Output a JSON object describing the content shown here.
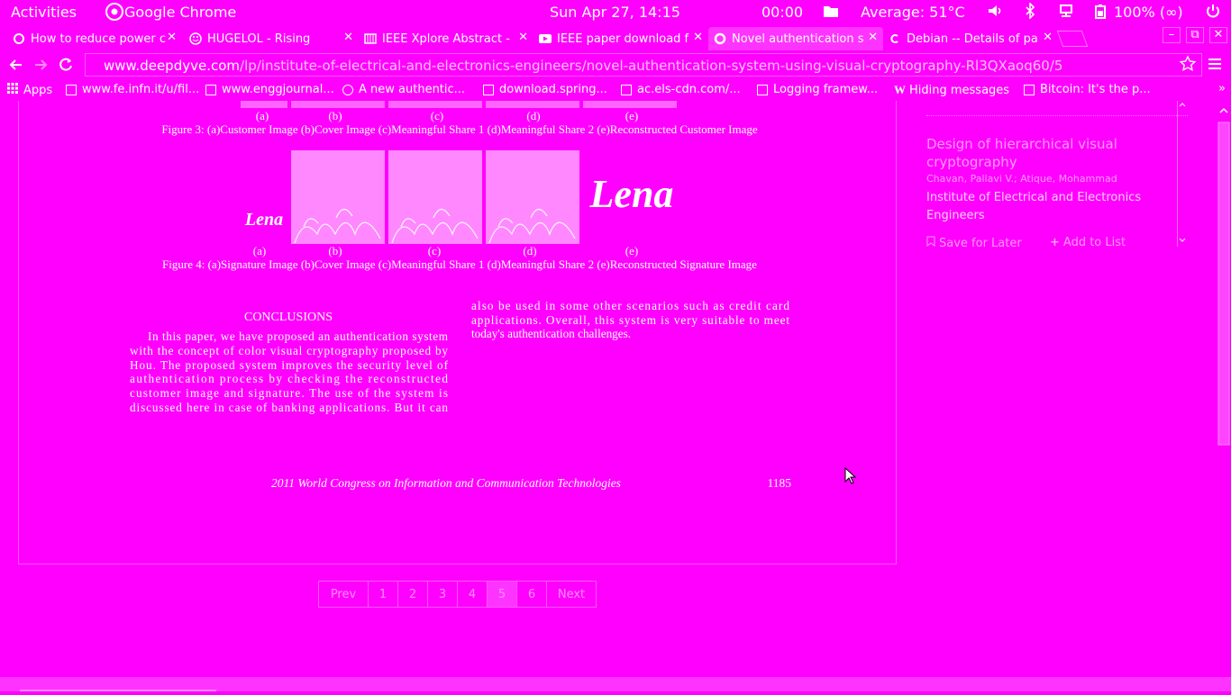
{
  "topbar": {
    "activities": "Activities",
    "app_name": "Google Chrome",
    "datetime": "Sun Apr 27, 14:15",
    "timer": "00:00",
    "temperature": "Average: 51°C",
    "battery": "100% (∞)"
  },
  "tabs": [
    {
      "title": "How to reduce power c"
    },
    {
      "title": "HUGELOL - Rising"
    },
    {
      "title": "IEEE Xplore Abstract -"
    },
    {
      "title": "IEEE paper download f"
    },
    {
      "title": "Novel authentication s"
    },
    {
      "title": "Debian -- Details of pa"
    }
  ],
  "omnibox": {
    "host": "www.deepdyve.com",
    "path": "/lp/institute-of-electrical-and-electronics-engineers/novel-authentication-system-using-visual-cryptography-Rl3QXaoq60/5"
  },
  "bookmarks": [
    {
      "label": "Apps"
    },
    {
      "label": "www.fe.infn.it/u/fil..."
    },
    {
      "label": "www.enggjournal..."
    },
    {
      "label": "A new authentic..."
    },
    {
      "label": "download.spring..."
    },
    {
      "label": "ac.els-cdn.com/..."
    },
    {
      "label": "Logging framew..."
    },
    {
      "label": "Hiding messages"
    },
    {
      "label": "Bitcoin: It's the p..."
    }
  ],
  "document": {
    "fig3_labels": [
      "(a)",
      "(b)",
      "(c)",
      "(d)",
      "(e)"
    ],
    "fig3_caption": "Figure 3: (a)Customer Image (b)Cover Image (c)Meaningful Share 1 (d)Meaningful Share 2 (e)Reconstructed Customer Image",
    "fig4_signature_small": "Lena",
    "fig4_signature_large": "Lena",
    "fig4_labels": [
      "(a)",
      "(b)",
      "(c)",
      "(d)",
      "(e)"
    ],
    "fig4_caption": "Figure 4: (a)Signature Image (b)Cover Image (c)Meaningful Share 1 (d)Meaningful Share 2 (e)Reconstructed Signature Image",
    "conclusions_heading": "CONCLUSIONS",
    "left_col_lines": [
      "In this paper, we have proposed an authentication system",
      "with the concept of color visual cryptography proposed by",
      "Hou. The proposed system improves the security level of",
      "authentication process by checking the reconstructed",
      "customer image and signature. The use of the system is",
      "discussed here in case of banking applications. But it can"
    ],
    "right_col_lines": [
      "also be used in some other scenarios such as credit card",
      "applications. Overall, this system is very suitable to meet",
      "today's authentication challenges."
    ],
    "footer_conference": "2011 World Congress on Information and Communication Technologies",
    "footer_page": "1185"
  },
  "sidebar": {
    "related_title": "Design of hierarchical visual cryptography",
    "authors": "Chavan, Pallavi V.; Atique, Mohammad",
    "publisher": "Institute of Electrical and Electronics Engineers",
    "save_label": "Save for Later",
    "add_label": "Add to List"
  },
  "pager": {
    "prev": "Prev",
    "pages": [
      "1",
      "2",
      "3",
      "4",
      "5",
      "6"
    ],
    "current_page": "5",
    "next": "Next"
  }
}
